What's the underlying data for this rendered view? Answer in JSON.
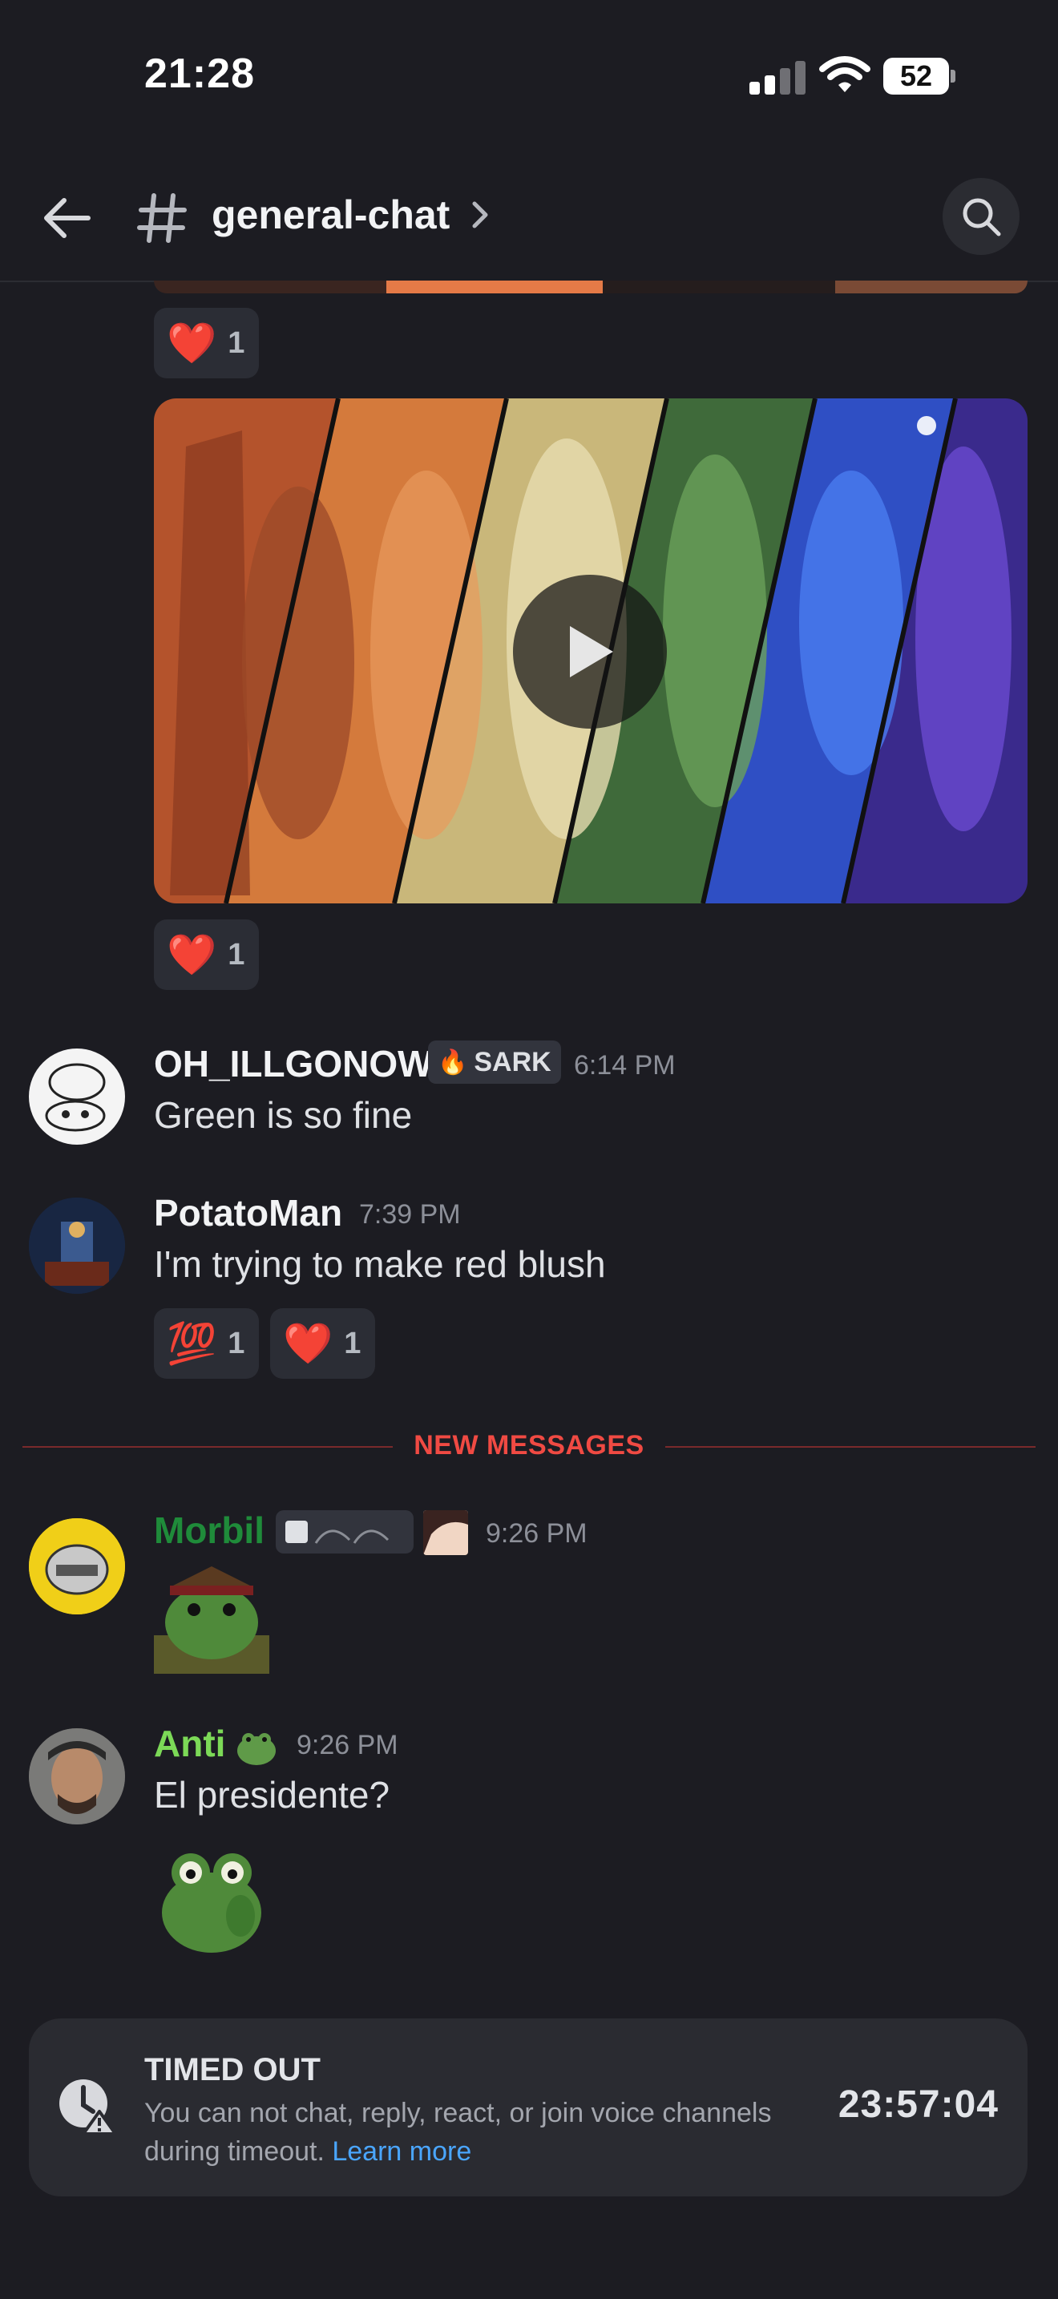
{
  "status_bar": {
    "time": "21:28",
    "battery": "52"
  },
  "header": {
    "channel_name": "general-chat",
    "icons": [
      "back-arrow-icon",
      "hash-icon",
      "chevron-right-icon",
      "search-icon"
    ]
  },
  "reactions_top": [
    {
      "emoji": "❤️",
      "count": "1"
    }
  ],
  "reactions_video": [
    {
      "emoji": "❤️",
      "count": "1"
    }
  ],
  "messages": [
    {
      "username": "OH_ILLGONOW",
      "username_color": "#f2f3f5",
      "tag": "SARK",
      "tag_icon": "fire-icon",
      "time": "6:14 PM",
      "text": "Green is so fine"
    },
    {
      "username": "PotatoMan",
      "username_color": "#f2f3f5",
      "time": "7:39 PM",
      "text": "I'm trying to make red blush",
      "reactions": [
        {
          "emoji": "💯",
          "count": "1"
        },
        {
          "emoji": "❤️",
          "count": "1"
        }
      ]
    },
    {
      "username": "Morbil",
      "username_color": "#1f8b3a",
      "time": "9:26 PM"
    },
    {
      "username": "Anti",
      "username_color": "#7cd957",
      "time": "9:26 PM",
      "text": "El presidente?"
    }
  ],
  "divider": {
    "label": "NEW MESSAGES"
  },
  "timeout": {
    "title": "TIMED OUT",
    "description": "You can not chat, reply, react, or join voice channels during timeout.",
    "link": "Learn more",
    "countdown": "23:57:04"
  },
  "colors": {
    "background": "#1c1c22",
    "accent_red": "#f04a43",
    "link_blue": "#4aa6ff"
  }
}
